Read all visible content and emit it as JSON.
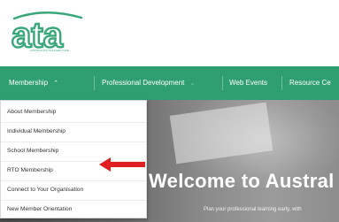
{
  "brand": {
    "logo_text": "ata",
    "logo_caption": "AUSTRALIAN TEACHER AIDE",
    "color": "#2f9f71"
  },
  "nav": {
    "items": [
      {
        "label": "Membership",
        "chevron": "chevron-up-icon"
      },
      {
        "label": "Professional Development",
        "chevron": "chevron-down-icon"
      },
      {
        "label": "Web Events"
      },
      {
        "label": "Resource Ce"
      }
    ]
  },
  "dropdown": {
    "items": [
      "About Membership",
      "Individual Membership",
      "School Membership",
      "RTO Membership",
      "Connect to Your Organisation",
      "New Member Orientation"
    ]
  },
  "hero": {
    "title": "Welcome to Austral",
    "subtitle": "Plan your professional learning early, with"
  },
  "annotation": {
    "arrow_color": "#e02020",
    "arrow_icon": "red-arrow-icon"
  }
}
